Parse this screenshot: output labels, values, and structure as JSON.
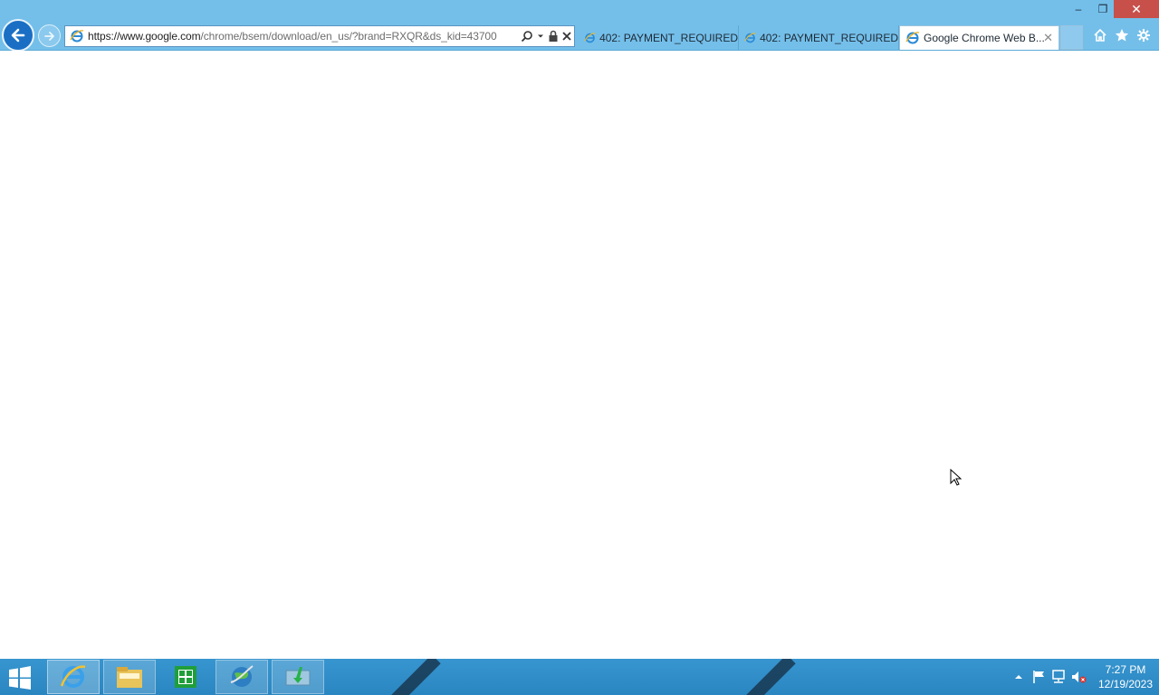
{
  "browser": {
    "address_url": "https://www.google.com/chrome/bsem/download/en_us/?brand=RXQR&ds_kid=43700",
    "url_host_part": "https://www.google.com",
    "url_path_part": "/chrome/bsem/download/en_us/?brand=RXQR&ds_kid=43700",
    "tabs": [
      {
        "label": "402: PAYMENT_REQUIRED",
        "icon": "ie-page-icon",
        "active": false
      },
      {
        "label": "402: PAYMENT_REQUIRED",
        "icon": "ie-page-icon",
        "active": false
      },
      {
        "label": "Google Chrome Web B...",
        "icon": "ie-page-icon",
        "active": true
      }
    ],
    "tab_close_glyph": "✕",
    "window_buttons": {
      "minimize": "–",
      "restore": "❐",
      "close": "✕"
    },
    "toolbar_icons": [
      "home-icon",
      "favorites-star-icon",
      "settings-gear-icon"
    ]
  },
  "taskbar": {
    "pinned": [
      "internet-explorer-icon",
      "file-explorer-icon",
      "store-icon",
      "network-globe-icon",
      "download-manager-icon"
    ],
    "tray_icons": [
      "show-hidden-icons-arrow",
      "action-center-flag-icon",
      "network-icon",
      "volume-muted-icon"
    ],
    "clock_time": "7:27 PM",
    "clock_date": "12/19/2023"
  },
  "colors": {
    "frame": "#74bfea",
    "taskbar": "#2f8cc8",
    "close_button": "#c7504a",
    "back_button": "#1a6fc4"
  }
}
